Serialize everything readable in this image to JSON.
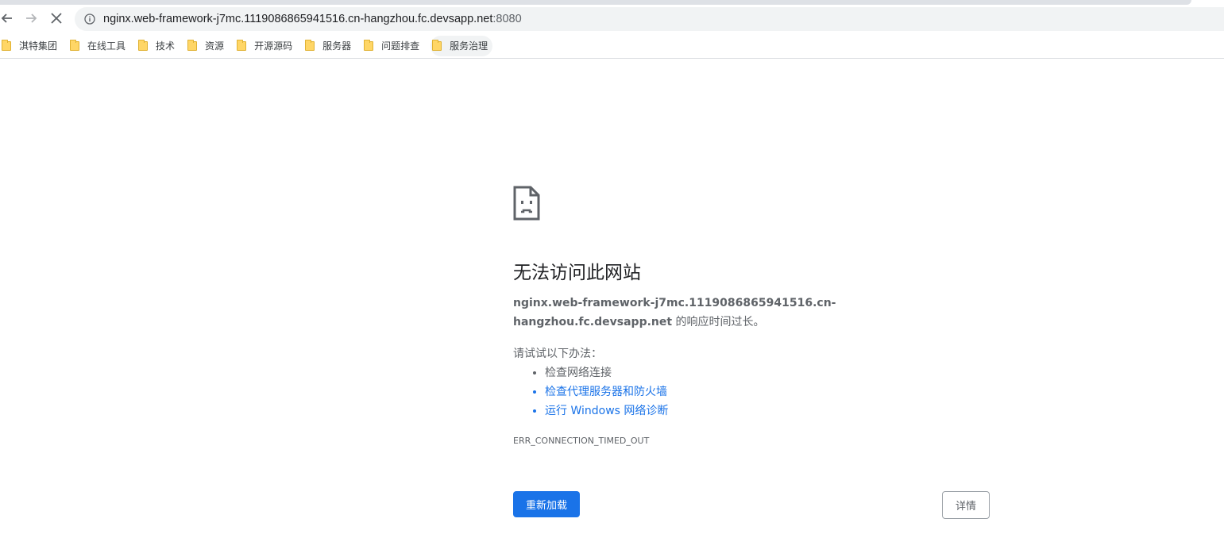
{
  "browser": {
    "url_host": "nginx.web-framework-j7mc.1119086865941516.cn-hangzhou.fc.devsapp.net",
    "url_port": ":8080",
    "bookmarks": [
      {
        "label": "淇特集团"
      },
      {
        "label": "在线工具"
      },
      {
        "label": "技术"
      },
      {
        "label": "资源"
      },
      {
        "label": "开源源码"
      },
      {
        "label": "服务器"
      },
      {
        "label": "问题排查"
      },
      {
        "label": "服务治理"
      }
    ]
  },
  "error_page": {
    "heading": "无法访问此网站",
    "host": "nginx.web-framework-j7mc.1119086865941516.cn-hangzhou.fc.devsapp.net",
    "summary_suffix": " 的响应时间过长。",
    "try_label": "请试试以下办法：",
    "suggestions": [
      {
        "text": "检查网络连接"
      },
      {
        "text": "检查代理服务器和防火墙"
      },
      {
        "text": "运行 Windows 网络诊断"
      }
    ],
    "error_code": "ERR_CONNECTION_TIMED_OUT",
    "reload_label": "重新加载",
    "details_label": "详情"
  },
  "colors": {
    "accent": "#1a73e8",
    "text_secondary": "#5f6368",
    "omnibox_bg": "#f1f3f4",
    "folder": "#ffd666"
  },
  "icons": {
    "back": "back-arrow-icon",
    "forward": "forward-arrow-icon",
    "stop": "stop-loading-icon",
    "info": "site-info-icon",
    "folder": "folder-icon",
    "sad_page": "sad-page-icon"
  }
}
